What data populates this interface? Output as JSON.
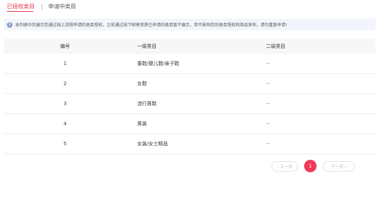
{
  "tabs": {
    "active": "已授权类目",
    "separator": "|",
    "other": "申请中类目"
  },
  "notice": {
    "icon": "info-icon",
    "text": "本列表中仅展示您通过线上流程申请的类目授权，之前通过线下邮寄资质已申请的类目暂不展示，但不影响您的类目授权和商品发布，请勿重复申请!"
  },
  "table": {
    "headers": [
      "编号",
      "一级类目",
      "二级类目"
    ],
    "rows": [
      {
        "id": "1",
        "level1": "童鞋/婴儿鞋/亲子鞋",
        "level2": "--"
      },
      {
        "id": "2",
        "level1": "女鞋",
        "level2": "--"
      },
      {
        "id": "3",
        "level1": "流行男鞋",
        "level2": "--"
      },
      {
        "id": "4",
        "level1": "男装",
        "level2": "--"
      },
      {
        "id": "5",
        "level1": "女装/女士精品",
        "level2": "--"
      }
    ]
  },
  "pagination": {
    "prev_label": "‹ 上一页",
    "current_page": "1",
    "next_label": "下一页 ›"
  },
  "colors": {
    "accent": "#e8384f",
    "notice_bg": "#f2f5fb",
    "header_bg": "#f7f7f7"
  }
}
